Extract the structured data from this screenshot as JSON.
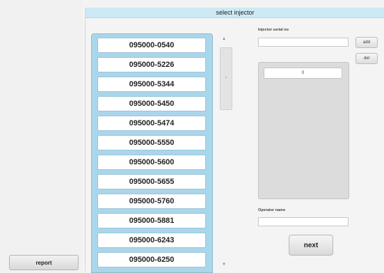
{
  "left": {
    "report_label": "report"
  },
  "main": {
    "title": "select injector",
    "injector_list": [
      "095000-0540",
      "095000-5226",
      "095000-5344",
      "095000-5450",
      "095000-5474",
      "095000-5550",
      "095000-5600",
      "095000-5655",
      "095000-5760",
      "095000-5881",
      "095000-6243",
      "095000-6250"
    ],
    "serial_label": "Injector serial no",
    "serial_value": "",
    "add_label": "add",
    "del_label": "del",
    "serial_items": [
      "0"
    ],
    "operator_label": "Operator name",
    "operator_value": "",
    "next_label": "next"
  }
}
